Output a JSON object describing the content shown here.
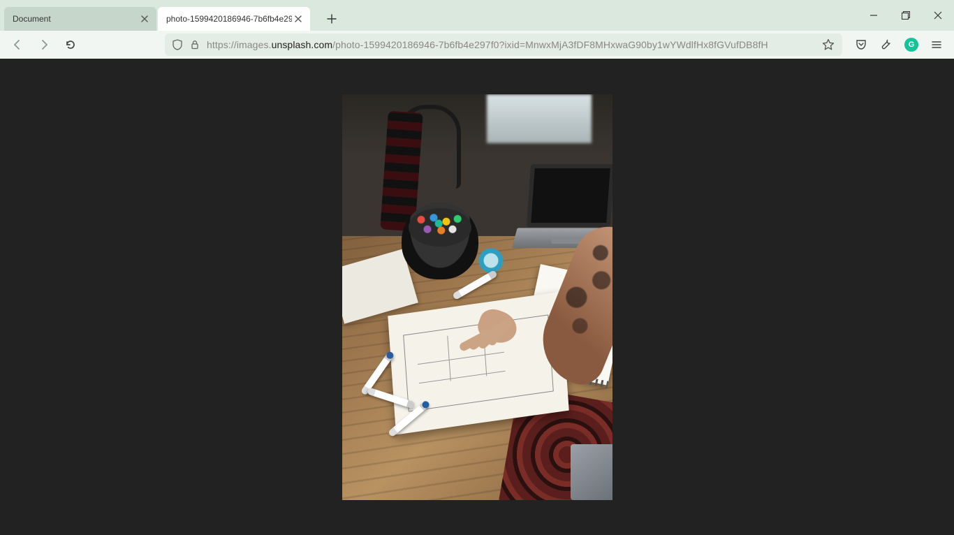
{
  "tabs": [
    {
      "title": "Document",
      "active": false
    },
    {
      "title": "photo-1599420186946-7b6fb4e297f…",
      "active": true
    }
  ],
  "url": {
    "scheme": "https://",
    "sub": "images.",
    "host": "unsplash.com",
    "path": "/photo-1599420186946-7b6fb4e297f0?ixid=MnwxMjA3fDF8MHxwaG90by1wYWdlfHx8fGVufDB8fH"
  },
  "grammarly_glyph": "G"
}
